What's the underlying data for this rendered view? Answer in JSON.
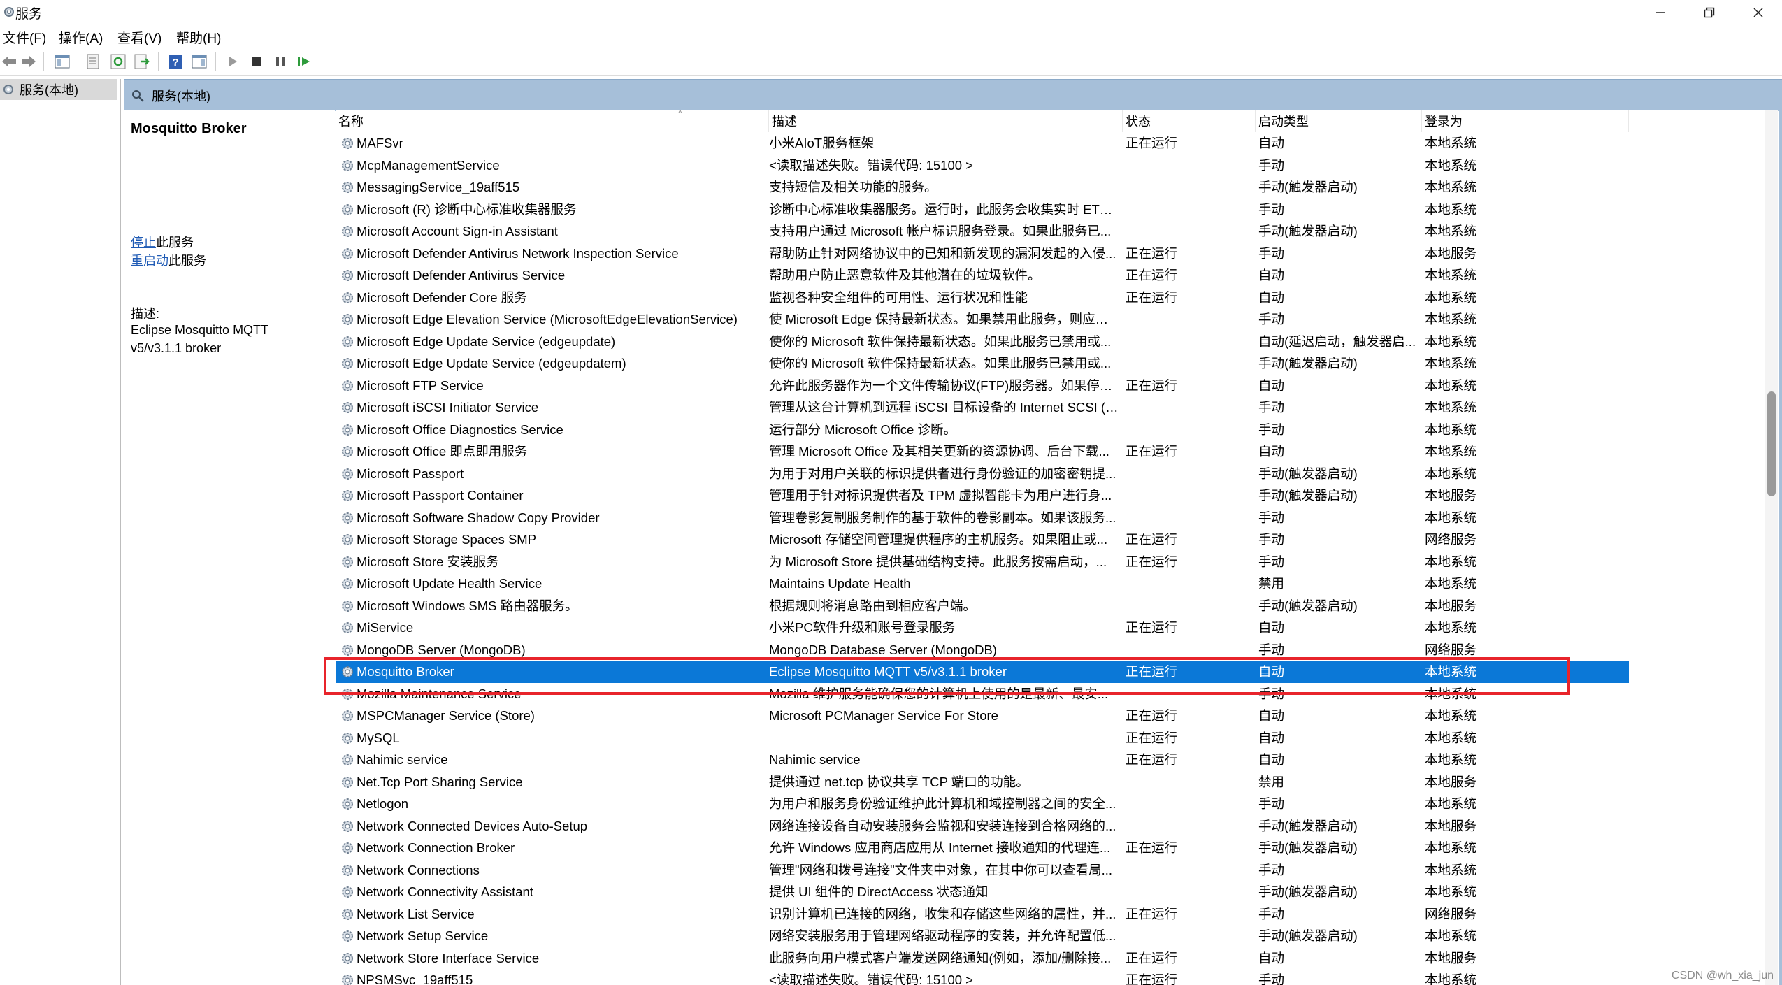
{
  "window": {
    "title": "服务"
  },
  "menu": [
    "文件(F)",
    "操作(A)",
    "查看(V)",
    "帮助(H)"
  ],
  "tree": {
    "item": "服务(本地)"
  },
  "tab": {
    "label": "服务(本地)"
  },
  "detail": {
    "service_name": "Mosquitto Broker",
    "stop_link": "停止",
    "stop_suffix": "此服务",
    "restart_link": "重启动",
    "restart_suffix": "此服务",
    "desc_label": "描述:",
    "desc_text": "Eclipse Mosquitto MQTT v5/v3.1.1 broker"
  },
  "columns": [
    "名称",
    "描述",
    "状态",
    "启动类型",
    "登录为"
  ],
  "rows": [
    {
      "name": "MAFSvr",
      "desc": "小米AIoT服务框架",
      "status": "正在运行",
      "startup": "自动",
      "logon": "本地系统"
    },
    {
      "name": "McpManagementService",
      "desc": "<读取描述失败。错误代码: 15100 >",
      "status": "",
      "startup": "手动",
      "logon": "本地系统"
    },
    {
      "name": "MessagingService_19aff515",
      "desc": "支持短信及相关功能的服务。",
      "status": "",
      "startup": "手动(触发器启动)",
      "logon": "本地系统"
    },
    {
      "name": "Microsoft (R) 诊断中心标准收集器服务",
      "desc": "诊断中心标准收集器服务。运行时，此服务会收集实时 ETW...",
      "status": "",
      "startup": "手动",
      "logon": "本地系统"
    },
    {
      "name": "Microsoft Account Sign-in Assistant",
      "desc": "支持用户通过 Microsoft 帐户标识服务登录。如果此服务已...",
      "status": "",
      "startup": "手动(触发器启动)",
      "logon": "本地系统"
    },
    {
      "name": "Microsoft Defender Antivirus Network Inspection Service",
      "desc": "帮助防止针对网络协议中的已知和新发现的漏洞发起的入侵...",
      "status": "正在运行",
      "startup": "手动",
      "logon": "本地服务"
    },
    {
      "name": "Microsoft Defender Antivirus Service",
      "desc": "帮助用户防止恶意软件及其他潜在的垃圾软件。",
      "status": "正在运行",
      "startup": "自动",
      "logon": "本地系统"
    },
    {
      "name": "Microsoft Defender Core 服务",
      "desc": "监视各种安全组件的可用性、运行状况和性能",
      "status": "正在运行",
      "startup": "自动",
      "logon": "本地系统"
    },
    {
      "name": "Microsoft Edge Elevation Service (MicrosoftEdgeElevationService)",
      "desc": "使 Microsoft Edge 保持最新状态。如果禁用此服务，则应用...",
      "status": "",
      "startup": "手动",
      "logon": "本地系统"
    },
    {
      "name": "Microsoft Edge Update Service (edgeupdate)",
      "desc": "使你的 Microsoft 软件保持最新状态。如果此服务已禁用或...",
      "status": "",
      "startup": "自动(延迟启动，触发器启...",
      "logon": "本地系统"
    },
    {
      "name": "Microsoft Edge Update Service (edgeupdatem)",
      "desc": "使你的 Microsoft 软件保持最新状态。如果此服务已禁用或...",
      "status": "",
      "startup": "手动(触发器启动)",
      "logon": "本地系统"
    },
    {
      "name": "Microsoft FTP Service",
      "desc": "允许此服务器作为一个文件传输协议(FTP)服务器。如果停止...",
      "status": "正在运行",
      "startup": "自动",
      "logon": "本地系统"
    },
    {
      "name": "Microsoft iSCSI Initiator Service",
      "desc": "管理从这台计算机到远程 iSCSI 目标设备的 Internet SCSI (i...",
      "status": "",
      "startup": "手动",
      "logon": "本地系统"
    },
    {
      "name": "Microsoft Office Diagnostics Service",
      "desc": "运行部分 Microsoft Office 诊断。",
      "status": "",
      "startup": "手动",
      "logon": "本地系统"
    },
    {
      "name": "Microsoft Office 即点即用服务",
      "desc": "管理 Microsoft Office 及其相关更新的资源协调、后台下载...",
      "status": "正在运行",
      "startup": "自动",
      "logon": "本地系统"
    },
    {
      "name": "Microsoft Passport",
      "desc": "为用于对用户关联的标识提供者进行身份验证的加密密钥提...",
      "status": "",
      "startup": "手动(触发器启动)",
      "logon": "本地系统"
    },
    {
      "name": "Microsoft Passport Container",
      "desc": "管理用于针对标识提供者及 TPM 虚拟智能卡为用户进行身...",
      "status": "",
      "startup": "手动(触发器启动)",
      "logon": "本地服务"
    },
    {
      "name": "Microsoft Software Shadow Copy Provider",
      "desc": "管理卷影复制服务制作的基于软件的卷影副本。如果该服务...",
      "status": "",
      "startup": "手动",
      "logon": "本地系统"
    },
    {
      "name": "Microsoft Storage Spaces SMP",
      "desc": "Microsoft 存储空间管理提供程序的主机服务。如果阻止或...",
      "status": "正在运行",
      "startup": "手动",
      "logon": "网络服务"
    },
    {
      "name": "Microsoft Store 安装服务",
      "desc": "为 Microsoft Store 提供基础结构支持。此服务按需启动，...",
      "status": "正在运行",
      "startup": "手动",
      "logon": "本地系统"
    },
    {
      "name": "Microsoft Update Health Service",
      "desc": "Maintains Update Health",
      "status": "",
      "startup": "禁用",
      "logon": "本地系统"
    },
    {
      "name": "Microsoft Windows SMS 路由器服务。",
      "desc": "根据规则将消息路由到相应客户端。",
      "status": "",
      "startup": "手动(触发器启动)",
      "logon": "本地服务"
    },
    {
      "name": "MiService",
      "desc": "小米PC软件升级和账号登录服务",
      "status": "正在运行",
      "startup": "自动",
      "logon": "本地系统"
    },
    {
      "name": "MongoDB Server (MongoDB)",
      "desc": "MongoDB Database Server (MongoDB)",
      "status": "",
      "startup": "手动",
      "logon": "网络服务"
    },
    {
      "name": "Mosquitto Broker",
      "desc": "Eclipse Mosquitto MQTT v5/v3.1.1 broker",
      "status": "正在运行",
      "startup": "自动",
      "logon": "本地系统",
      "selected": true
    },
    {
      "name": "Mozilla Maintenance Service",
      "desc": "Mozilla 维护服务能确保您的计算机上使用的是最新、最安...",
      "status": "",
      "startup": "手动",
      "logon": "本地系统"
    },
    {
      "name": "MSPCManager Service (Store)",
      "desc": "Microsoft PCManager Service For Store",
      "status": "正在运行",
      "startup": "自动",
      "logon": "本地系统"
    },
    {
      "name": "MySQL",
      "desc": "",
      "status": "正在运行",
      "startup": "自动",
      "logon": "本地系统"
    },
    {
      "name": "Nahimic service",
      "desc": "Nahimic service",
      "status": "正在运行",
      "startup": "自动",
      "logon": "本地系统"
    },
    {
      "name": "Net.Tcp Port Sharing Service",
      "desc": "提供通过 net.tcp 协议共享 TCP 端口的功能。",
      "status": "",
      "startup": "禁用",
      "logon": "本地服务"
    },
    {
      "name": "Netlogon",
      "desc": "为用户和服务身份验证维护此计算机和域控制器之间的安全...",
      "status": "",
      "startup": "手动",
      "logon": "本地系统"
    },
    {
      "name": "Network Connected Devices Auto-Setup",
      "desc": "网络连接设备自动安装服务会监视和安装连接到合格网络的...",
      "status": "",
      "startup": "手动(触发器启动)",
      "logon": "本地服务"
    },
    {
      "name": "Network Connection Broker",
      "desc": "允许 Windows 应用商店应用从 Internet 接收通知的代理连...",
      "status": "正在运行",
      "startup": "手动(触发器启动)",
      "logon": "本地系统"
    },
    {
      "name": "Network Connections",
      "desc": "管理\"网络和拨号连接\"文件夹中对象，在其中你可以查看局...",
      "status": "",
      "startup": "手动",
      "logon": "本地系统"
    },
    {
      "name": "Network Connectivity Assistant",
      "desc": "提供 UI 组件的 DirectAccess 状态通知",
      "status": "",
      "startup": "手动(触发器启动)",
      "logon": "本地系统"
    },
    {
      "name": "Network List Service",
      "desc": "识别计算机已连接的网络，收集和存储这些网络的属性，并...",
      "status": "正在运行",
      "startup": "手动",
      "logon": "网络服务"
    },
    {
      "name": "Network Setup Service",
      "desc": "网络安装服务用于管理网络驱动程序的安装，并允许配置低...",
      "status": "",
      "startup": "手动(触发器启动)",
      "logon": "本地系统"
    },
    {
      "name": "Network Store Interface Service",
      "desc": "此服务向用户模式客户端发送网络通知(例如，添加/删除接...",
      "status": "正在运行",
      "startup": "自动",
      "logon": "本地服务"
    },
    {
      "name": "NPSMSvc_19aff515",
      "desc": "<读取描述失败。错误代码: 15100 >",
      "status": "正在运行",
      "startup": "手动",
      "logon": "本地系统"
    }
  ],
  "watermark": "CSDN @wh_xia_jun",
  "colors": {
    "selection": "#0b78d7",
    "highlight_box": "#e8242b",
    "tab_bar": "#a6bfd9"
  }
}
